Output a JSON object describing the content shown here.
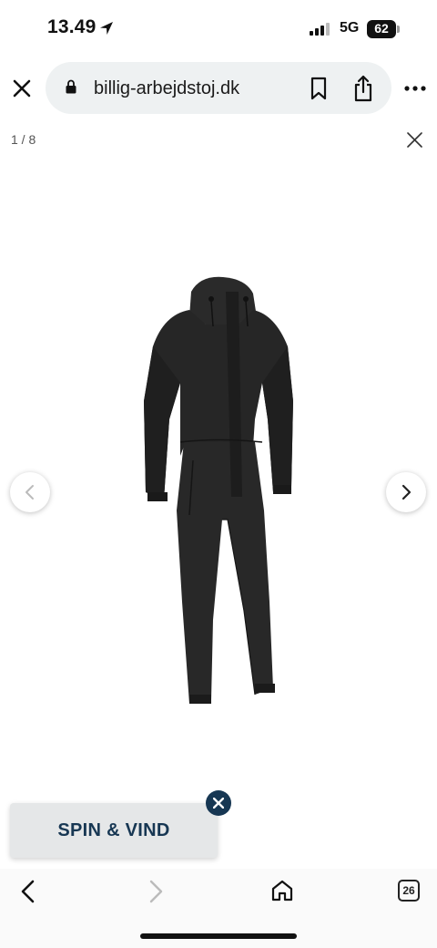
{
  "status_bar": {
    "time": "13.49",
    "network": "5G",
    "battery": "62"
  },
  "browser": {
    "url": "billig-arbejdstoj.dk",
    "tab_count": "26"
  },
  "gallery": {
    "counter": "1 / 8",
    "product_icon": "coverall-jumpsuit-photo"
  },
  "promo": {
    "label": "SPIN & VIND"
  },
  "colors": {
    "promo_text": "#173753",
    "url_bar_bg": "#eef1f2"
  }
}
